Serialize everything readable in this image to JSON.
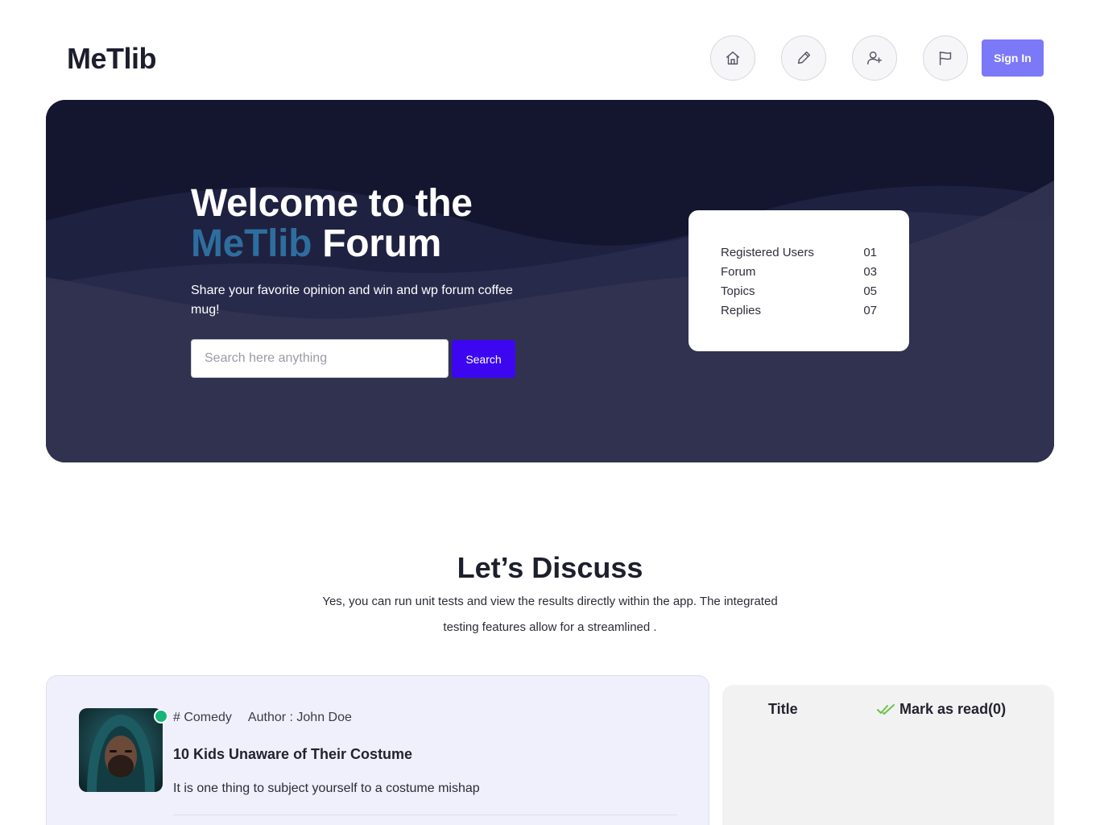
{
  "header": {
    "logo": "MeTlib",
    "nav_icons": [
      "home-icon",
      "pencil-icon",
      "add-user-icon",
      "flag-icon"
    ],
    "signin_label": "Sign In"
  },
  "hero": {
    "title_line1": "Welcome to the",
    "title_accent": "MeTlib",
    "title_rest": " Forum",
    "subtitle": "Share your favorite opinion and win and wp forum coffee mug!",
    "search_placeholder": "Search here anything",
    "search_value": "",
    "search_button": "Search",
    "stats": [
      {
        "label": "Registered Users",
        "value": "01"
      },
      {
        "label": "Forum",
        "value": "03"
      },
      {
        "label": "Topics",
        "value": "05"
      },
      {
        "label": "Replies",
        "value": "07"
      }
    ]
  },
  "discuss": {
    "title": "Let’s Discuss",
    "subtitle": "Yes, you can run unit tests and view the results directly within the app. The integrated testing features allow for a streamlined ."
  },
  "post": {
    "tag": "# Comedy",
    "author": "Author : John Doe",
    "title": "10 Kids Unaware of Their Costume",
    "excerpt": "It is one thing to subject yourself to a costume mishap"
  },
  "sidebar_panel": {
    "title": "Title",
    "mark_read": "Mark as read(0)"
  },
  "colors": {
    "accent": "#7b79f7",
    "search_button": "#3c07f0",
    "hero_bg": "#14152f",
    "title_accent": "#2e6e9e",
    "online": "#16b57a",
    "check": "#6cc24a"
  }
}
